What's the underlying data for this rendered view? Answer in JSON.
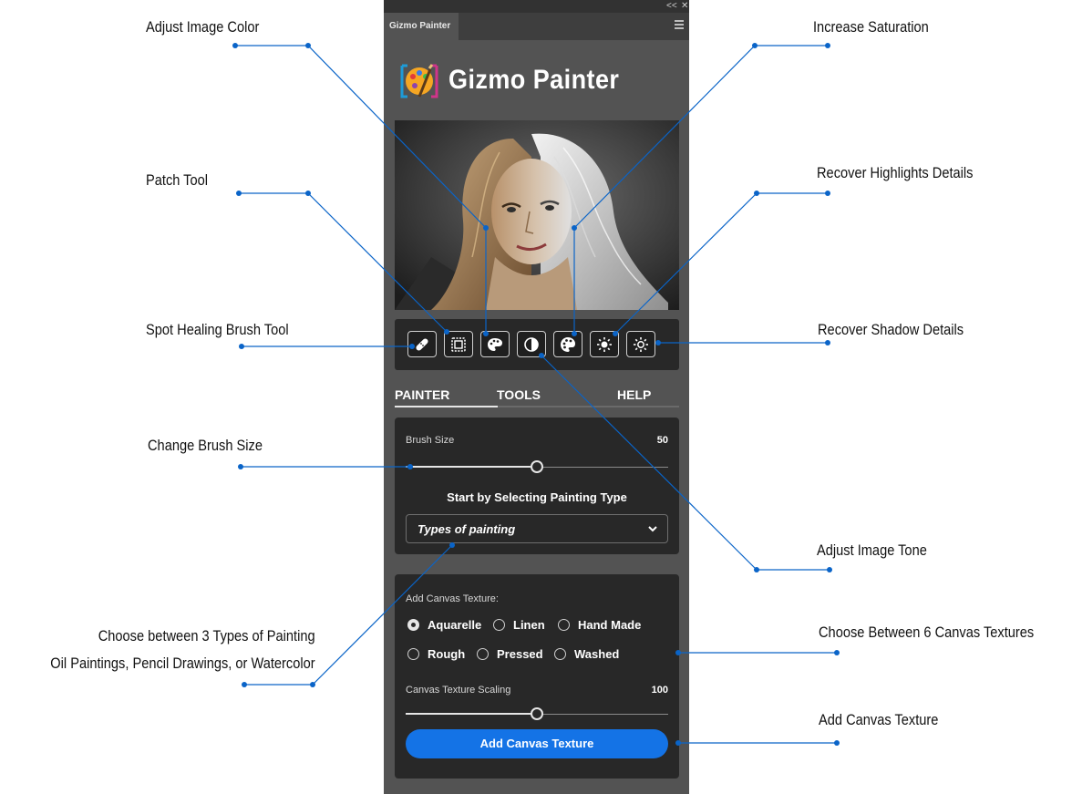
{
  "panel": {
    "tab_label": "Gizmo Painter",
    "collapse_glyph": "<<",
    "close_glyph": "✕",
    "app_title": "Gizmo Painter"
  },
  "tools": [
    {
      "name": "spot-healing-brush",
      "icon": "bandage-icon"
    },
    {
      "name": "patch-tool",
      "icon": "patch-icon"
    },
    {
      "name": "adjust-color",
      "icon": "palette-icon"
    },
    {
      "name": "adjust-tone",
      "icon": "contrast-icon"
    },
    {
      "name": "increase-saturation",
      "icon": "palette-filled-icon"
    },
    {
      "name": "recover-highlights",
      "icon": "sun-filled-icon"
    },
    {
      "name": "recover-shadows",
      "icon": "sun-outline-icon"
    }
  ],
  "tabs": [
    "PAINTER",
    "TOOLS",
    "HELP"
  ],
  "active_tab": "PAINTER",
  "painter": {
    "brush_size_label": "Brush Size",
    "brush_size_value": "50",
    "brush_size_fraction": 0.5,
    "start_text": "Start by Selecting Painting Type",
    "type_select_value": "Types of painting"
  },
  "canvas": {
    "texture_label": "Add Canvas Texture:",
    "textures": [
      "Aquarelle",
      "Linen",
      "Hand Made",
      "Rough",
      "Pressed",
      "Washed"
    ],
    "selected_texture": "Aquarelle",
    "scaling_label": "Canvas Texture Scaling",
    "scaling_value": "100",
    "scaling_fraction": 0.5,
    "button_label": "Add Canvas Texture"
  },
  "callouts": {
    "adjust_color": "Adjust Image Color",
    "patch_tool": "Patch Tool",
    "spot_healing": "Spot Healing Brush Tool",
    "brush_size": "Change Brush Size",
    "painting_types_1": "Choose between 3 Types of Painting",
    "painting_types_2": "Oil Paintings, Pencil Drawings, or Watercolor",
    "saturation": "Increase Saturation",
    "highlights": "Recover Highlights Details",
    "shadows": "Recover Shadow Details",
    "tone": "Adjust Image Tone",
    "textures": "Choose Between 6 Canvas Textures",
    "add_texture": "Add Canvas Texture"
  },
  "colors": {
    "panel_bg": "#535353",
    "card_bg": "#282828",
    "accent_blue": "#1473e6",
    "callout_line": "#0a64c8"
  }
}
